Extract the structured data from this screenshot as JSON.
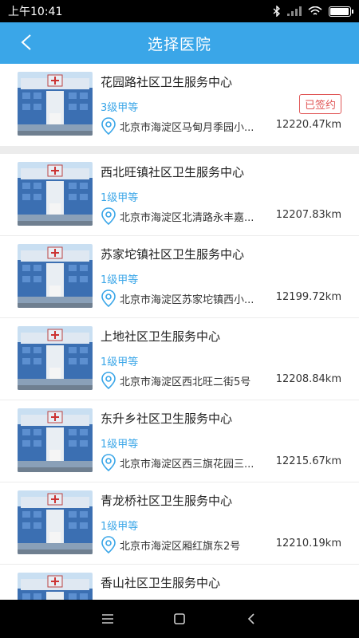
{
  "status_bar": {
    "time": "上午10:41",
    "icons": [
      "bluetooth-icon",
      "signal-icon",
      "wifi-icon",
      "battery-icon"
    ],
    "battery_level": 0.9
  },
  "header": {
    "title": "选择医院",
    "back_icon": "chevron-left-icon"
  },
  "colors": {
    "accent": "#3aa6e8",
    "signed_badge": "#e05656",
    "divider": "#ececec"
  },
  "hospitals": [
    {
      "name": "花园路社区卫生服务中心",
      "grade": "3级甲等",
      "badge": "已签约",
      "address": "北京市海淀区马甸月季园小...",
      "distance": "12220.47km"
    },
    {
      "name": "西北旺镇社区卫生服务中心",
      "grade": "1级甲等",
      "address": "北京市海淀区北清路永丰嘉...",
      "distance": "12207.83km"
    },
    {
      "name": "苏家坨镇社区卫生服务中心",
      "grade": "1级甲等",
      "address": "北京市海淀区苏家坨镇西小...",
      "distance": "12199.72km"
    },
    {
      "name": "上地社区卫生服务中心",
      "grade": "1级甲等",
      "address": "北京市海淀区西北旺二街5号",
      "distance": "12208.84km"
    },
    {
      "name": "东升乡社区卫生服务中心",
      "grade": "1级甲等",
      "address": "北京市海淀区西三旗花园三...",
      "distance": "12215.67km"
    },
    {
      "name": "青龙桥社区卫生服务中心",
      "grade": "1级甲等",
      "address": "北京市海淀区厢红旗东2号",
      "distance": "12210.19km"
    },
    {
      "name": "香山社区卫生服务中心"
    }
  ],
  "nav_bar": {
    "buttons": [
      "menu-icon",
      "home-icon",
      "back-icon"
    ]
  }
}
